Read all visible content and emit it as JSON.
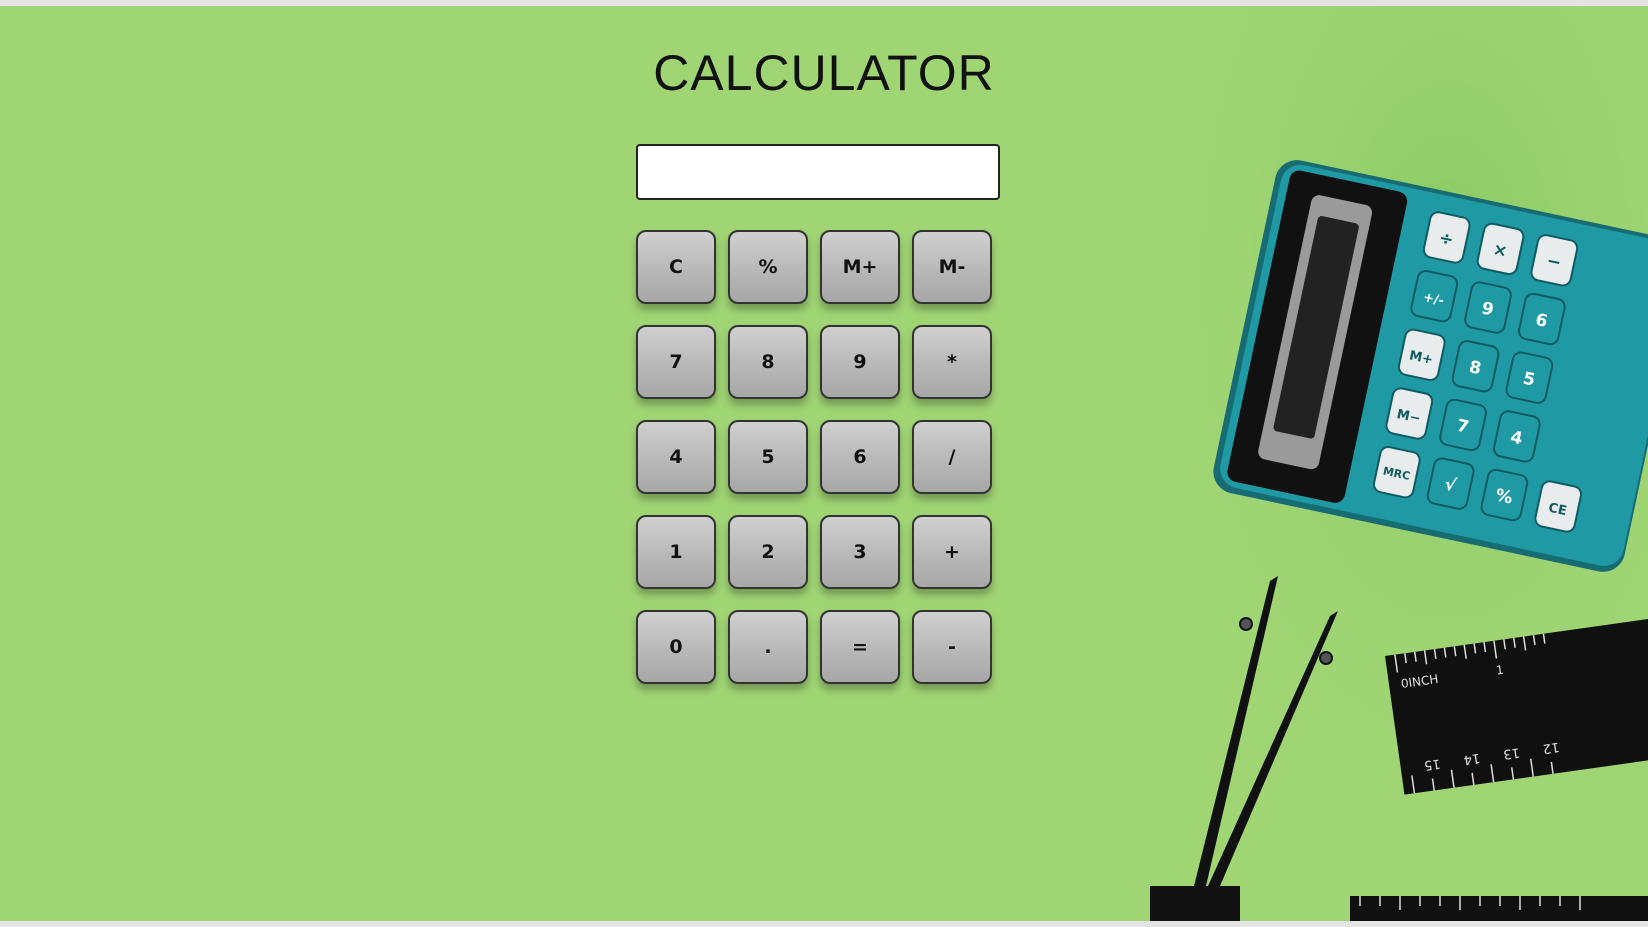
{
  "app": {
    "title": "CALCULATOR"
  },
  "display": {
    "value": ""
  },
  "keys": [
    [
      "C",
      "%",
      "M+",
      "M-"
    ],
    [
      "7",
      "8",
      "9",
      "*"
    ],
    [
      "4",
      "5",
      "6",
      "/"
    ],
    [
      "1",
      "2",
      "3",
      "+"
    ],
    [
      "0",
      ".",
      "=",
      "-"
    ]
  ],
  "background": {
    "color": "#a0d574",
    "device_keys": [
      "÷",
      "×",
      "−",
      "+/-",
      "9",
      "6",
      "M+",
      "8",
      "5",
      "M−",
      "7",
      "4",
      "MRC",
      "√",
      "%",
      "CE"
    ],
    "ruler_labels": [
      "0INCH",
      "1",
      "15",
      "14",
      "13",
      "12"
    ]
  },
  "colors": {
    "key_face": "#bdbdbd",
    "key_border": "#333333",
    "device_teal": "#1f9aa4"
  }
}
